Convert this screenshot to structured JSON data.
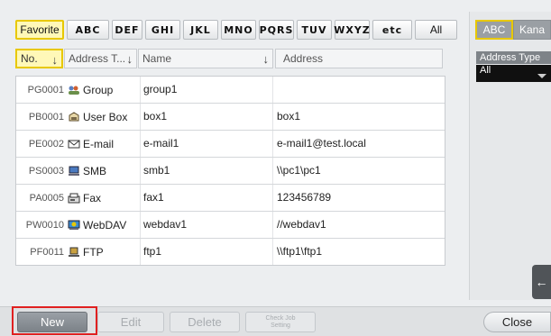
{
  "index_tabs": [
    "Favorite",
    "ABC",
    "DEF",
    "GHI",
    "JKL",
    "MNO",
    "PQRS",
    "TUV",
    "WXYZ",
    "etc",
    "All"
  ],
  "charset_toggle": {
    "abc": "ABC",
    "kana": "Kana"
  },
  "address_type": {
    "label": "Address Type",
    "value": "All"
  },
  "columns": {
    "no": "No.",
    "type": "Address T...",
    "name": "Name",
    "address": "Address"
  },
  "rows": [
    {
      "no": "PG0001",
      "type": "Group",
      "icon": "group-icon",
      "name": "group1",
      "address": ""
    },
    {
      "no": "PB0001",
      "type": "User Box",
      "icon": "user-box-icon",
      "name": "box1",
      "address": "box1"
    },
    {
      "no": "PE0002",
      "type": "E-mail",
      "icon": "email-icon",
      "name": "e-mail1",
      "address": "e-mail1@test.local"
    },
    {
      "no": "PS0003",
      "type": "SMB",
      "icon": "smb-icon",
      "name": "smb1",
      "address": "\\\\pc1\\pc1"
    },
    {
      "no": "PA0005",
      "type": "Fax",
      "icon": "fax-icon",
      "name": "fax1",
      "address": "123456789"
    },
    {
      "no": "PW0010",
      "type": "WebDAV",
      "icon": "webdav-icon",
      "name": "webdav1",
      "address": "//webdav1"
    },
    {
      "no": "PF0011",
      "type": "FTP",
      "icon": "ftp-icon",
      "name": "ftp1",
      "address": "\\\\ftp1\\ftp1"
    }
  ],
  "buttons": {
    "new": "New",
    "edit": "Edit",
    "delete": "Delete",
    "check_job_1": "Check Job",
    "check_job_2": "Setting",
    "close": "Close",
    "back": "←"
  },
  "colors": {
    "accent": "#e8c800",
    "selected_bg": "#fff8b8",
    "highlight": "#e02020"
  }
}
